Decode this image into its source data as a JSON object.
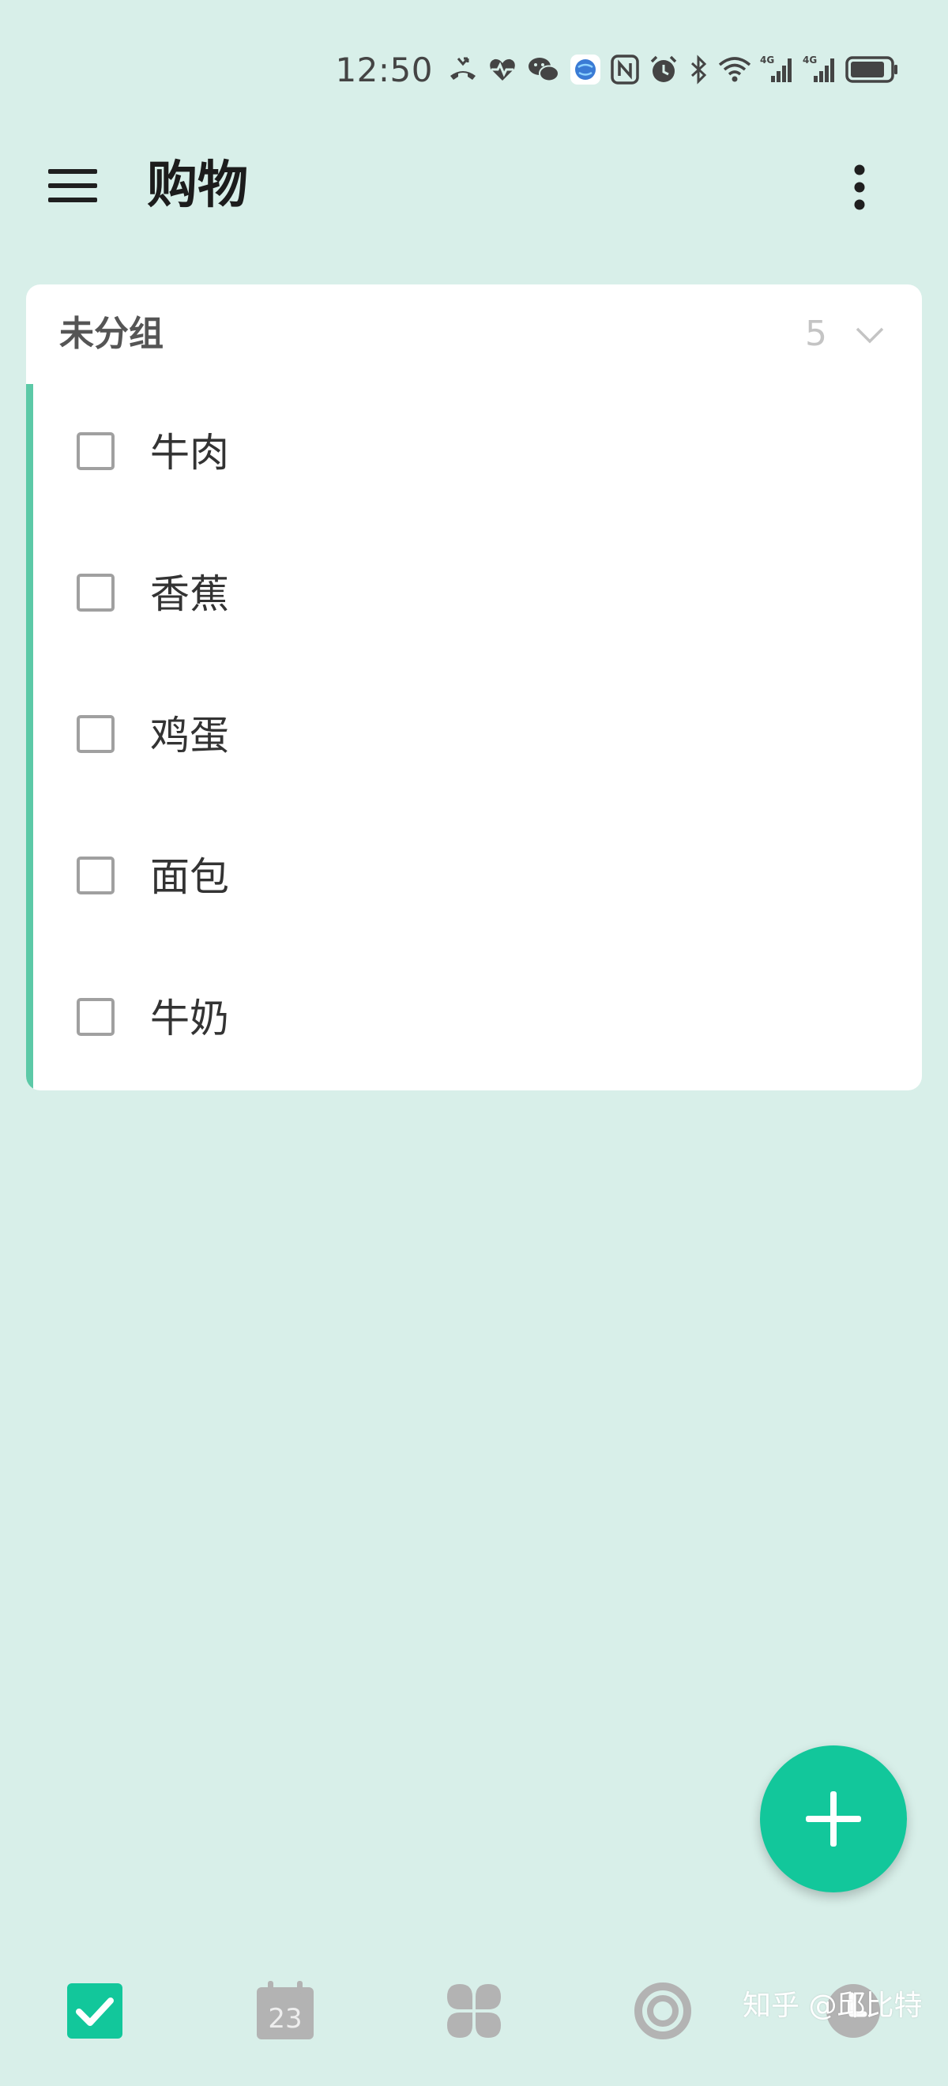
{
  "status_bar": {
    "time": "12:50",
    "icons": [
      "missed-call-icon",
      "heart-rate-icon",
      "wechat-icon",
      "browser-app-icon",
      "nfc-icon",
      "alarm-icon",
      "bluetooth-icon",
      "wifi-icon",
      "signal-4g-icon",
      "signal-4g-icon",
      "battery-icon"
    ],
    "network_label_1": "4G",
    "network_label_2": "4G"
  },
  "app_bar": {
    "title": "购物",
    "menu_icon": "hamburger-menu-icon",
    "more_icon": "more-vertical-icon"
  },
  "group": {
    "title": "未分组",
    "count": "5",
    "chevron_icon": "chevron-down-icon"
  },
  "tasks": [
    {
      "label": "牛肉",
      "checked": false
    },
    {
      "label": "香蕉",
      "checked": false
    },
    {
      "label": "鸡蛋",
      "checked": false
    },
    {
      "label": "面包",
      "checked": false
    },
    {
      "label": "牛奶",
      "checked": false
    }
  ],
  "fab": {
    "icon": "plus-icon"
  },
  "bottom_nav": {
    "items": [
      {
        "icon": "task-check-icon",
        "active": true
      },
      {
        "icon": "calendar-icon",
        "day": "23",
        "active": false
      },
      {
        "icon": "grid-apps-icon",
        "active": false
      },
      {
        "icon": "focus-ring-icon",
        "active": false
      },
      {
        "icon": "clock-icon",
        "active": false
      }
    ]
  },
  "watermark": "知乎 @邱比特",
  "colors": {
    "background": "#d8efe9",
    "accent": "#12c79b",
    "accent_bar": "#5cc9a7",
    "nav_inactive": "#b3b3b3",
    "card": "#ffffff"
  }
}
